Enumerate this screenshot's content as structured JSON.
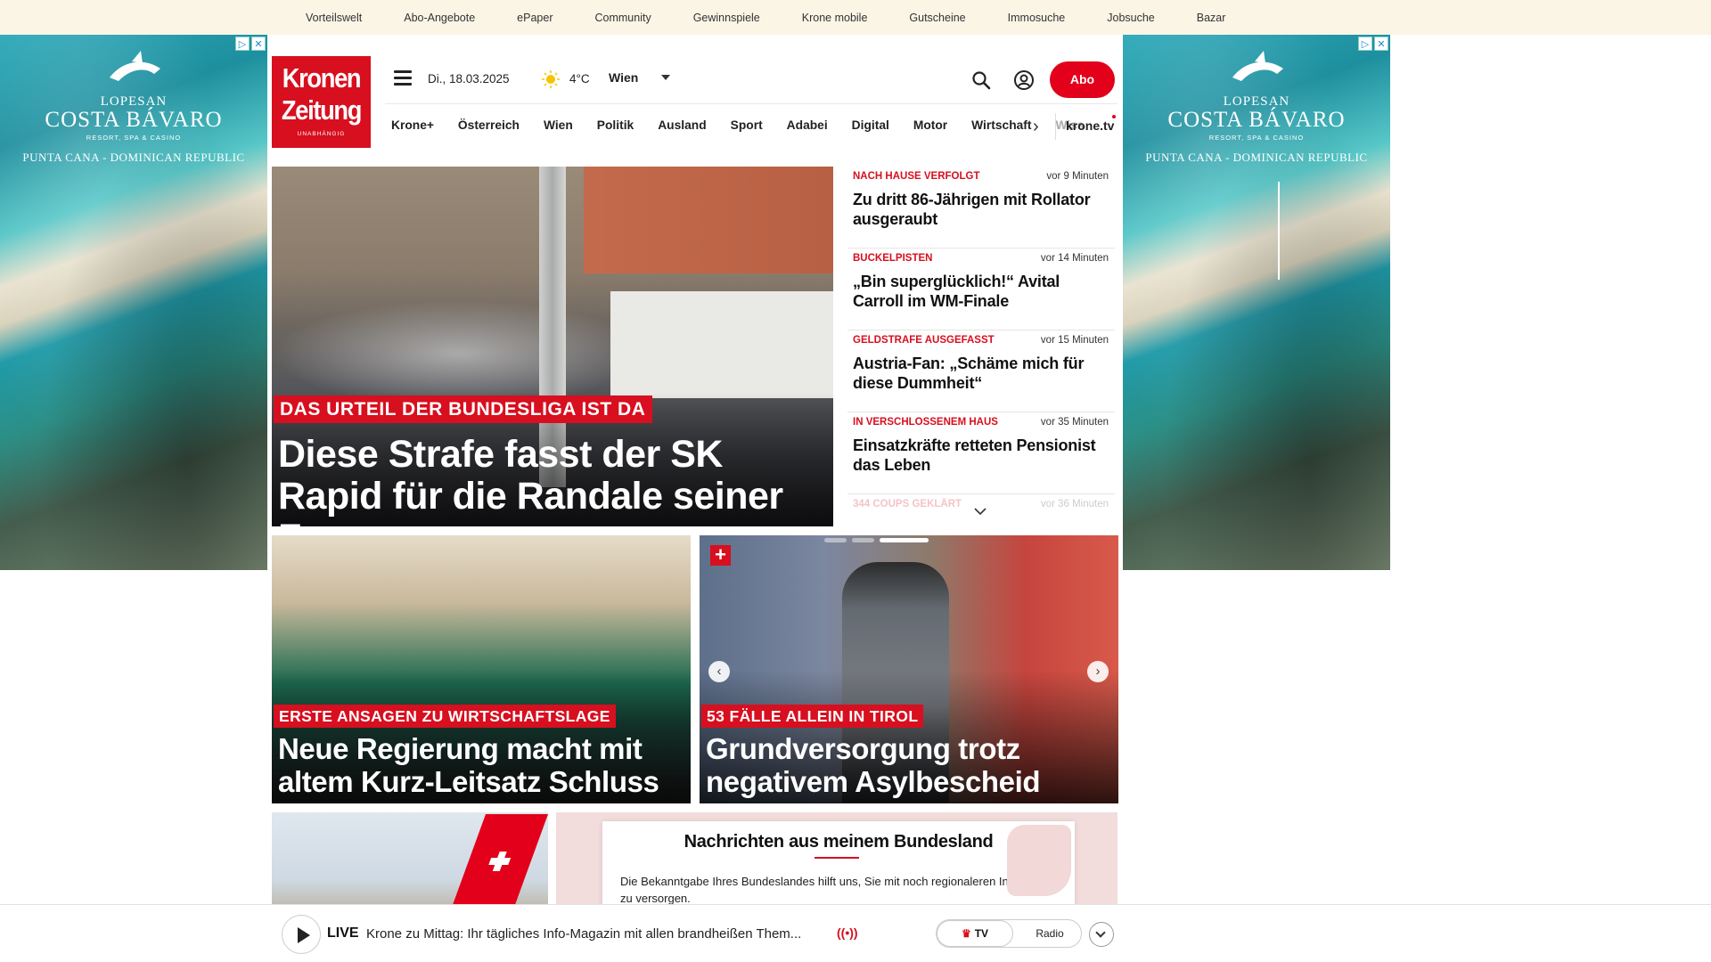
{
  "top_links": [
    "Vorteilswelt",
    "Abo-Angebote",
    "ePaper",
    "Community",
    "Gewinnspiele",
    "Krone mobile",
    "Gutscheine",
    "Immosuche",
    "Jobsuche",
    "Bazar"
  ],
  "ad": {
    "line1": "LOPESAN",
    "line2": "COSTA BÁVARO",
    "line3": "RESORT, SPA & CASINO",
    "line4": "PUNTA CANA - DOMINICAN REPUBLIC",
    "badge_info": "▷",
    "badge_close": "✕"
  },
  "logo": {
    "line1": "Kronen",
    "line2": "Zeitung",
    "tagline": "UNABHÄNGIG"
  },
  "header": {
    "date": "Di., 18.03.2025",
    "temperature": "4°C",
    "city": "Wien",
    "abo_label": "Abo"
  },
  "nav": {
    "items": [
      "Krone+",
      "Österreich",
      "Wien",
      "Politik",
      "Ausland",
      "Sport",
      "Adabei",
      "Digital",
      "Motor",
      "Wirtschaft",
      "Wiss"
    ],
    "tv_label": "krone.tv"
  },
  "hero": {
    "kicker": "DAS URTEIL DER BUNDESLIGA IST DA",
    "title": "Diese Strafe fasst der SK Rapid für die Randale seiner Fans aus"
  },
  "ticker": [
    {
      "kicker": "NACH HAUSE VERFOLGT",
      "time": "vor 9 Minuten",
      "title": "Zu dritt 86-Jährigen mit Rollator ausgeraubt"
    },
    {
      "kicker": "BUCKELPISTEN",
      "time": "vor 14 Minuten",
      "title": "„Bin superglücklich!“ Avital Carroll im WM-Finale"
    },
    {
      "kicker": "GELDSTRAFE AUSGEFASST",
      "time": "vor 15 Minuten",
      "title": "Austria-Fan: „Schäme mich für diese Dummheit“"
    },
    {
      "kicker": "IN VERSCHLOSSENEM HAUS",
      "time": "vor 35 Minuten",
      "title": "Einsatzkräfte retteten Pensionist das Leben"
    },
    {
      "kicker": "344 COUPS GEKLÄRT",
      "time": "vor 36 Minuten",
      "title": ""
    }
  ],
  "cards": [
    {
      "kicker": "ERSTE ANSAGEN ZU WIRTSCHAFTSLAGE",
      "title": "Neue Regierung macht mit altem Kurz-Leitsatz Schluss"
    },
    {
      "kicker": "53 FÄLLE ALLEIN IN TIROL",
      "title": "Grundversorgung trotz negativem Asylbescheid"
    }
  ],
  "carousel": {
    "plus_badge": "+",
    "prev": "‹",
    "next": "›"
  },
  "modal": {
    "title": "Nachrichten aus meinem Bundesland",
    "text": "Die Bekanntgabe Ihres Bundeslandes hilft uns, Sie mit noch regionaleren Inhalten zu versorgen."
  },
  "player": {
    "live_label": "LIVE",
    "title": "Krone zu Mittag: Ihr tägliches Info-Magazin mit allen brandheißen Them...",
    "radio_icon": "((•))",
    "tv_label": "TV",
    "tv_crown": "♛",
    "radio_label": "Radio"
  },
  "colors": {
    "brand_red": "#d70f1f",
    "topbar_bg": "#fbf5e6"
  }
}
